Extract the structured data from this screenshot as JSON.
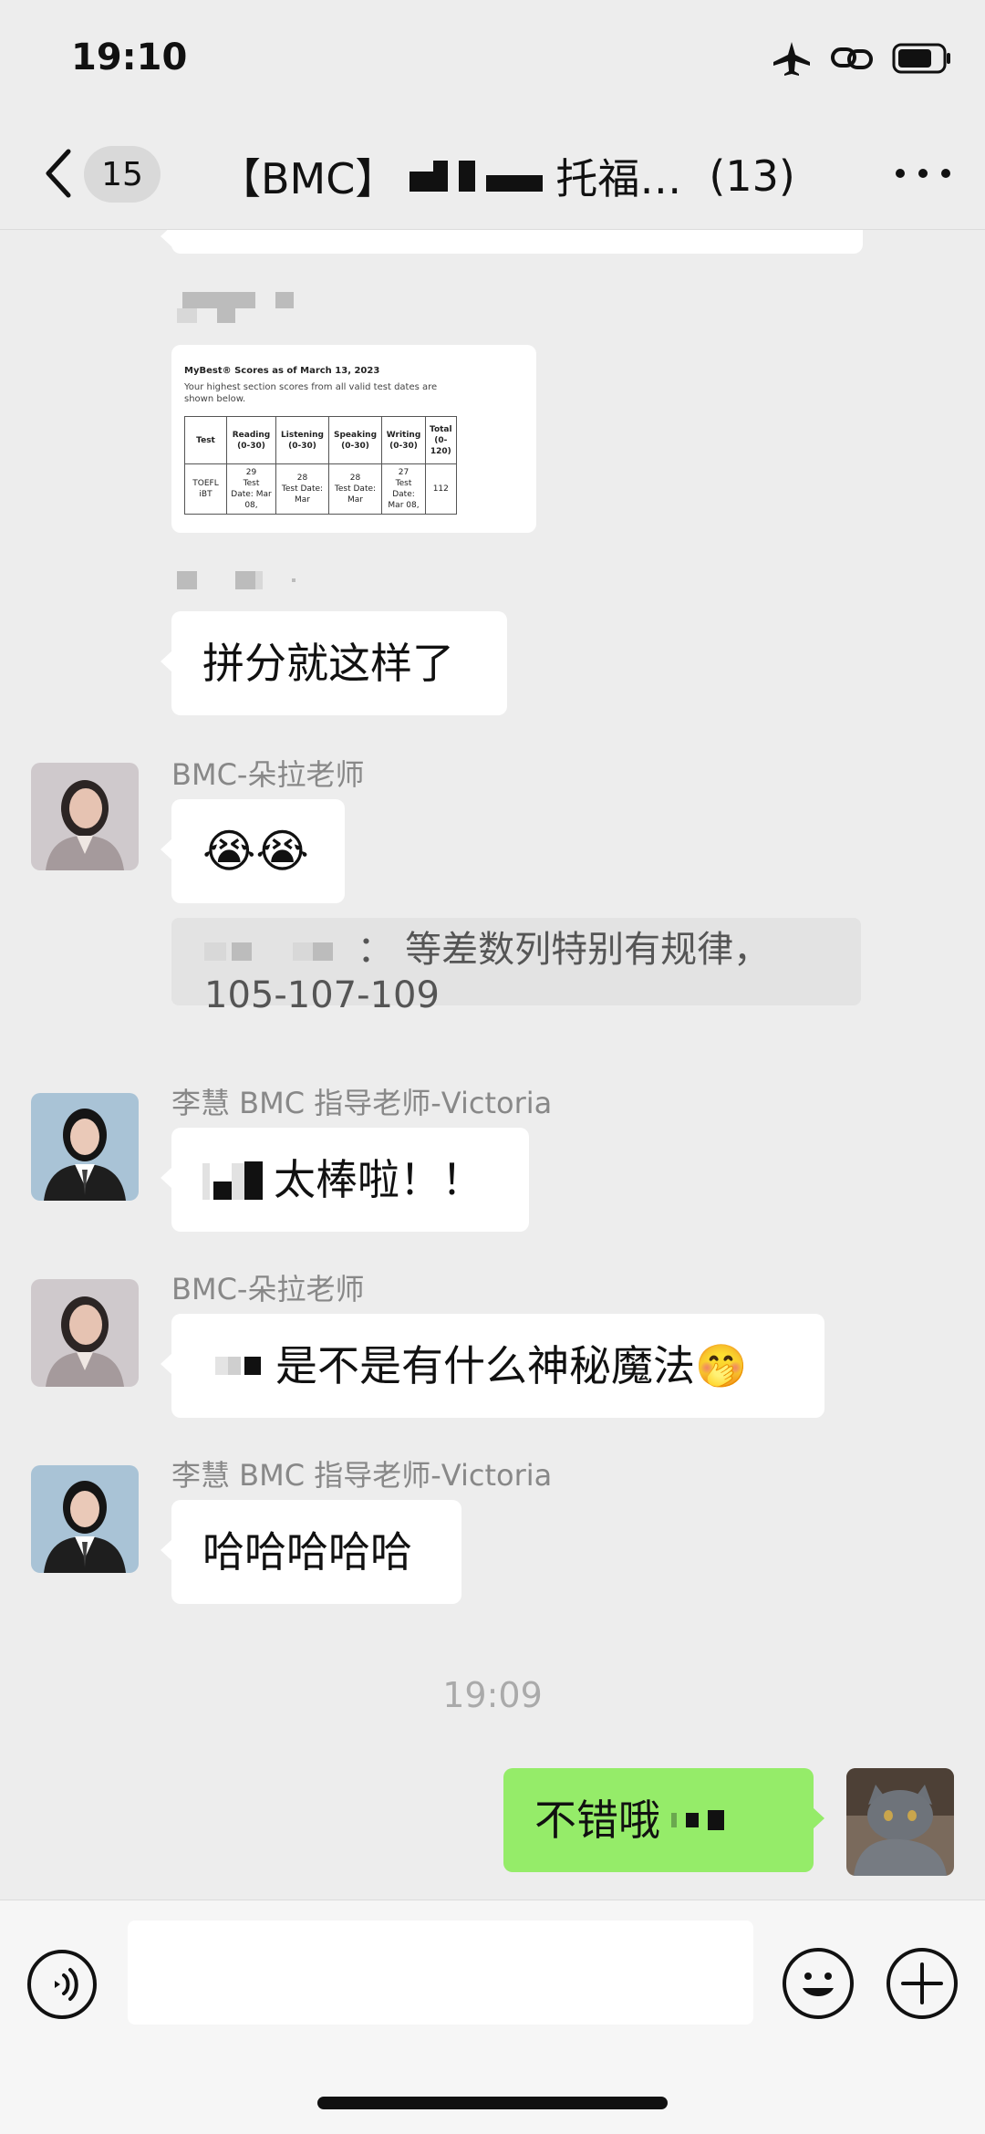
{
  "status_bar": {
    "time": "19:10"
  },
  "nav": {
    "unread_count": "15",
    "title_prefix": "【BMC】",
    "title_suffix": "托福…",
    "member_count": "(13)"
  },
  "score_card": {
    "title": "MyBest® Scores as of March 13, 2023",
    "subtitle": "Your highest section scores from all valid test dates are shown below.",
    "headers": [
      "Test",
      "Reading (0-30)",
      "Listening (0-30)",
      "Speaking (0-30)",
      "Writing (0-30)",
      "Total (0-120)"
    ],
    "row": {
      "test": "TOEFL iBT",
      "reading_score": "29",
      "reading_date": "Test Date: Mar 08,",
      "listening_score": "28",
      "listening_date": "Test Date: Mar",
      "speaking_score": "28",
      "speaking_date": "Test Date: Mar",
      "writing_score": "27",
      "writing_date": "Test Date: Mar 08,",
      "total": "112"
    }
  },
  "messages": {
    "m1_text": "拼分就这样了",
    "m2_sender": "BMC-朵拉老师",
    "m2_emoji": "😭😭",
    "quote_text": "： 等差数列特别有规律，105-107-109",
    "m3_sender": "李慧 BMC 指导老师-Victoria",
    "m3_text": "太棒啦！！",
    "m4_sender": "BMC-朵拉老师",
    "m4_text": "是不是有什么神秘魔法🤭",
    "m5_sender": "李慧 BMC 指导老师-Victoria",
    "m5_text": "哈哈哈哈哈",
    "timestamp": "19:09",
    "m6_text": "不错哦"
  },
  "icons": {
    "back": "chevron-left-icon",
    "more": "more-dots-icon",
    "airplane": "airplane-icon",
    "link": "link-icon",
    "battery": "battery-icon",
    "voice": "voice-icon",
    "emoji": "emoji-icon",
    "plus": "plus-icon"
  },
  "colors": {
    "background": "#ededed",
    "own_bubble": "#95ec69",
    "other_bubble": "#ffffff",
    "meta_text": "#888888"
  }
}
